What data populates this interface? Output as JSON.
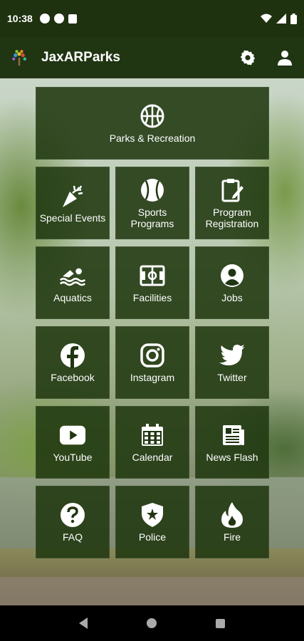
{
  "status_bar": {
    "time": "10:38"
  },
  "app_bar": {
    "title": "JaxARParks"
  },
  "tiles": {
    "parks": "Parks & Recreation",
    "special_events": "Special Events",
    "sports_programs": "Sports\nPrograms",
    "program_registration": "Program\nRegistration",
    "aquatics": "Aquatics",
    "facilities": "Facilities",
    "jobs": "Jobs",
    "facebook": "Facebook",
    "instagram": "Instagram",
    "twitter": "Twitter",
    "youtube": "YouTube",
    "calendar": "Calendar",
    "news_flash": "News Flash",
    "faq": "FAQ",
    "police": "Police",
    "fire": "Fire"
  },
  "colors": {
    "primary": "#203512",
    "tile": "#20380f",
    "text": "#ffffff"
  }
}
